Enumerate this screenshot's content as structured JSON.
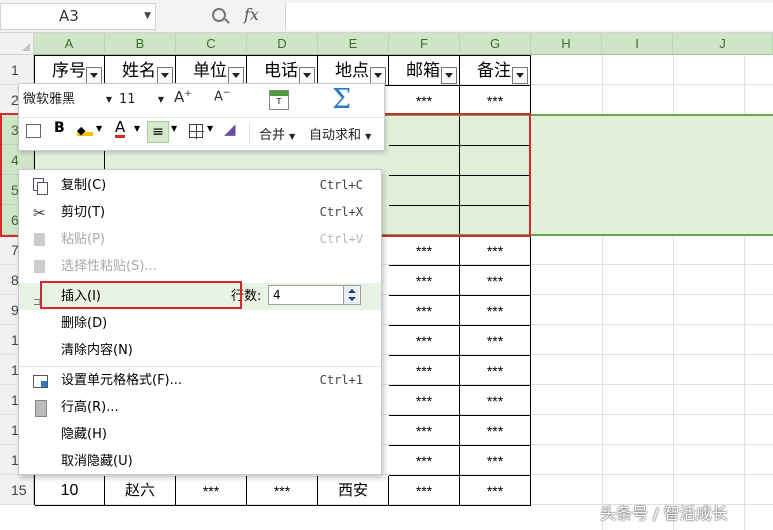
{
  "formula_bar": {
    "name_box": "A3",
    "fx_label": "fx"
  },
  "columns": [
    "A",
    "B",
    "C",
    "D",
    "E",
    "F",
    "G",
    "H",
    "I",
    "J"
  ],
  "rows": [
    "1",
    "2",
    "3",
    "4",
    "5",
    "6",
    "7",
    "8",
    "9",
    "1",
    "1",
    "1",
    "1",
    "1",
    "15"
  ],
  "table_headers": [
    "序号",
    "姓名",
    "单位",
    "电话",
    "地点",
    "邮箱",
    "备注"
  ],
  "placeholder": "***",
  "last_row": {
    "index": "10",
    "name": "赵六",
    "unit": "***",
    "phone": "***",
    "place": "西安",
    "mail": "***",
    "note": "***"
  },
  "mini_toolbar": {
    "font_name": "微软雅黑",
    "font_size": "11",
    "bold_label": "B",
    "font_color_label": "A",
    "merge_label": "合并",
    "autosum_label": "自动求和"
  },
  "context_menu": {
    "items": [
      {
        "label": "复制(C)",
        "shortcut": "Ctrl+C",
        "icon": "copy-icon",
        "enabled": true
      },
      {
        "label": "剪切(T)",
        "shortcut": "Ctrl+X",
        "icon": "scissors-icon",
        "enabled": true
      },
      {
        "label": "粘贴(P)",
        "shortcut": "Ctrl+V",
        "icon": "paste-icon",
        "enabled": false
      },
      {
        "label": "选择性粘贴(S)...",
        "shortcut": "",
        "icon": "paste-special-icon",
        "enabled": false
      },
      {
        "label": "插入(I)",
        "shortcut": "",
        "icon": "insert-icon",
        "enabled": true
      },
      {
        "label": "删除(D)",
        "shortcut": "",
        "icon": "",
        "enabled": true
      },
      {
        "label": "清除内容(N)",
        "shortcut": "",
        "icon": "",
        "enabled": true
      },
      {
        "label": "设置单元格格式(F)...",
        "shortcut": "Ctrl+1",
        "icon": "format-cells-icon",
        "enabled": true
      },
      {
        "label": "行高(R)...",
        "shortcut": "",
        "icon": "row-height-icon",
        "enabled": true
      },
      {
        "label": "隐藏(H)",
        "shortcut": "",
        "icon": "",
        "enabled": true
      },
      {
        "label": "取消隐藏(U)",
        "shortcut": "",
        "icon": "",
        "enabled": true
      }
    ],
    "insert_count_label": "行数:",
    "insert_count_value": "4"
  },
  "watermark": "头条号 / 智活成长",
  "colors": {
    "selection_fill": "#e2f0d9",
    "header_green": "#cfe5c7",
    "highlight_red": "#d9262c",
    "sum_blue": "#2b79c8"
  }
}
